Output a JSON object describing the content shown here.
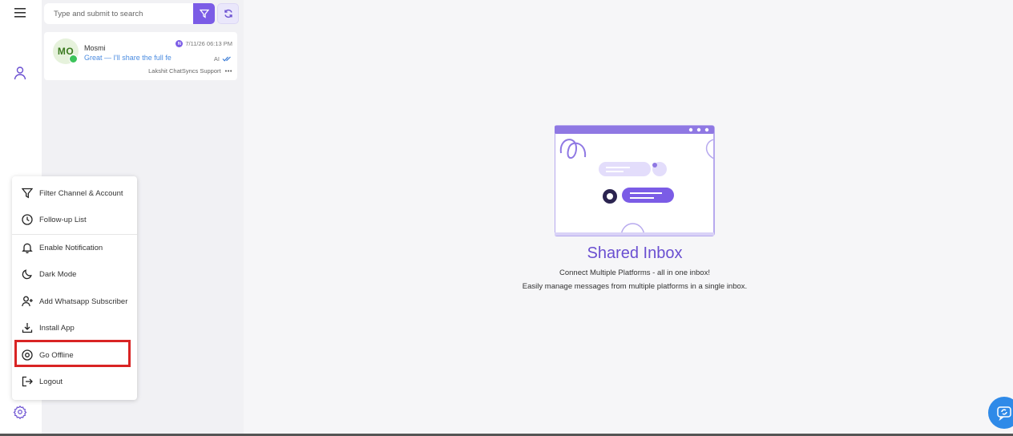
{
  "search": {
    "placeholder": "Type and submit to search"
  },
  "conversations": [
    {
      "initials": "MO",
      "name": "Mosmi",
      "preview": "Great — I'll share the full fe",
      "time": "7/11/26 06:13 PM",
      "tag": "N",
      "ai_label": "AI",
      "agent": "Lakshit ChatSyncs Support",
      "more": "•••"
    }
  ],
  "menu": {
    "items": [
      {
        "label": "Filter Channel & Account",
        "icon": "filter-icon"
      },
      {
        "label": "Follow-up List",
        "icon": "clock-icon"
      },
      {
        "label": "Enable Notification",
        "icon": "bell-icon"
      },
      {
        "label": "Dark Mode",
        "icon": "moon-icon"
      },
      {
        "label": "Add Whatsapp Subscriber",
        "icon": "user-plus-icon"
      },
      {
        "label": "Install App",
        "icon": "download-icon"
      },
      {
        "label": "Go Offline",
        "icon": "offline-icon"
      },
      {
        "label": "Logout",
        "icon": "logout-icon"
      }
    ]
  },
  "empty_state": {
    "title": "Shared Inbox",
    "line1": "Connect Multiple Platforms - all in one inbox!",
    "line2": "Easily manage messages from multiple platforms in a single inbox."
  },
  "colors": {
    "accent": "#7b5ce6",
    "highlight": "#d92424",
    "preview_text": "#4a8be0",
    "fab": "#2f8ae8"
  }
}
